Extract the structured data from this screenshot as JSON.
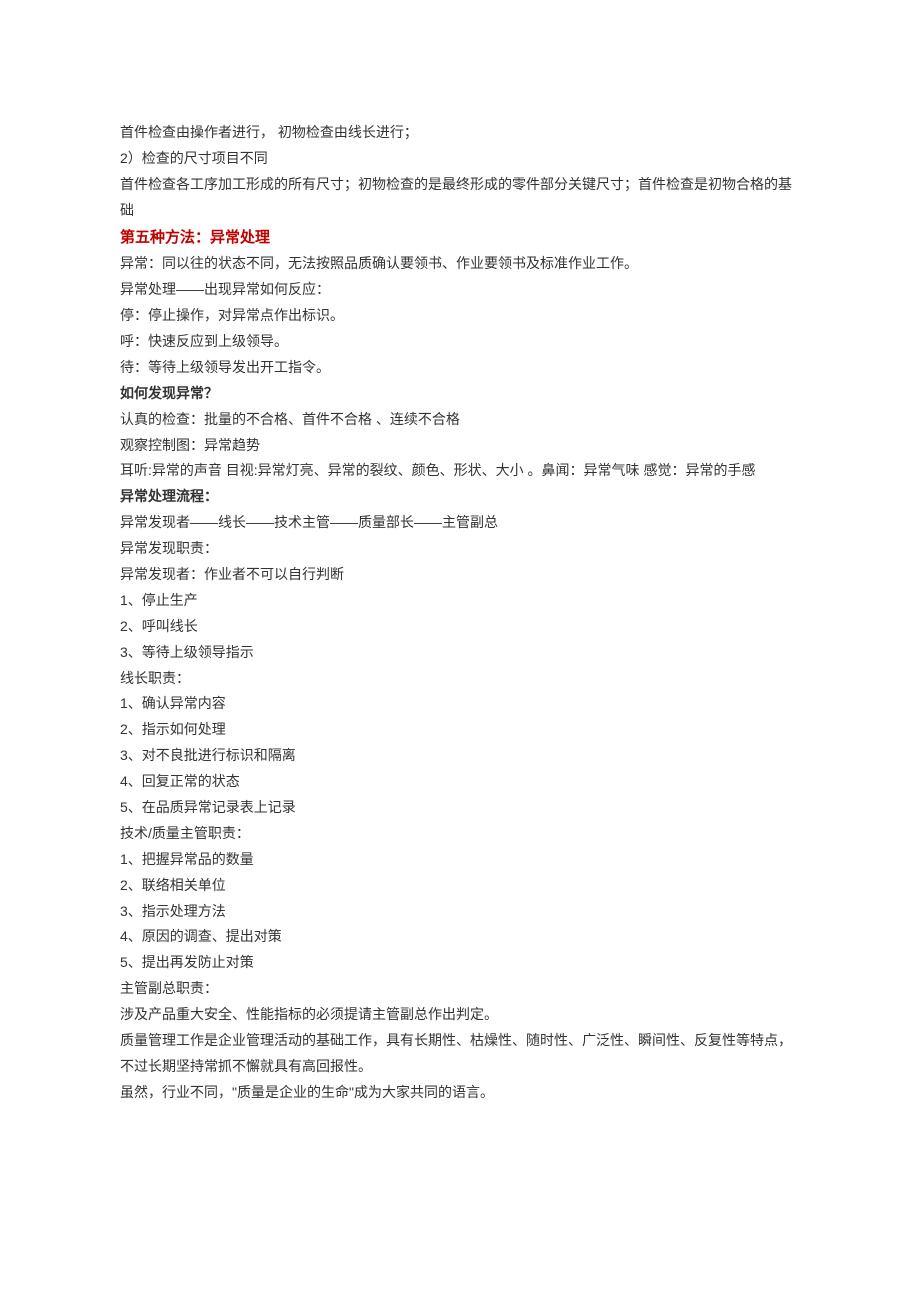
{
  "lines": [
    {
      "text": "首件检查由操作者进行，   初物检查由线长进行；",
      "class": ""
    },
    {
      "text": "2）检查的尺寸项目不同",
      "class": ""
    },
    {
      "text": "首件检查各工序加工形成的所有尺寸；初物检查的是最终形成的零件部分关键尺寸；首件检查是初物合格的基础",
      "class": ""
    },
    {
      "text": "第五种方法：异常处理",
      "class": "heading-red"
    },
    {
      "text": "异常：同以往的状态不同，无法按照品质确认要领书、作业要领书及标准作业工作。",
      "class": ""
    },
    {
      "text": "异常处理——出现异常如何反应：",
      "class": ""
    },
    {
      "text": "停：停止操作，对异常点作出标识。",
      "class": ""
    },
    {
      "text": "呼：快速反应到上级领导。",
      "class": ""
    },
    {
      "text": "待：等待上级领导发出开工指令。",
      "class": ""
    },
    {
      "text": "如何发现异常？",
      "class": "bold"
    },
    {
      "text": "认真的检查：批量的不合格、首件不合格 、连续不合格",
      "class": ""
    },
    {
      "text": "观察控制图：异常趋势",
      "class": ""
    },
    {
      "text": "耳听:异常的声音  目视:异常灯亮、异常的裂纹、颜色、形状、大小 。鼻闻：异常气味   感觉：异常的手感",
      "class": ""
    },
    {
      "text": "异常处理流程：",
      "class": "bold"
    },
    {
      "text": "异常发现者——线长——技术主管——质量部长——主管副总",
      "class": ""
    },
    {
      "text": "异常发现职责：",
      "class": ""
    },
    {
      "text": "异常发现者：作业者不可以自行判断",
      "class": ""
    },
    {
      "text": "1、停止生产",
      "class": ""
    },
    {
      "text": "2、呼叫线长",
      "class": ""
    },
    {
      "text": "3、等待上级领导指示",
      "class": ""
    },
    {
      "text": "线长职责：",
      "class": ""
    },
    {
      "text": "1、确认异常内容",
      "class": ""
    },
    {
      "text": "2、指示如何处理",
      "class": ""
    },
    {
      "text": "3、对不良批进行标识和隔离",
      "class": ""
    },
    {
      "text": "4、回复正常的状态",
      "class": ""
    },
    {
      "text": "5、在品质异常记录表上记录",
      "class": ""
    },
    {
      "text": "技术/质量主管职责：",
      "class": ""
    },
    {
      "text": "1、把握异常品的数量",
      "class": ""
    },
    {
      "text": "2、联络相关单位",
      "class": ""
    },
    {
      "text": "3、指示处理方法",
      "class": ""
    },
    {
      "text": "4、原因的调查、提出对策",
      "class": ""
    },
    {
      "text": "5、提出再发防止对策",
      "class": ""
    },
    {
      "text": "主管副总职责：",
      "class": ""
    },
    {
      "text": "涉及产品重大安全、性能指标的必须提请主管副总作出判定。",
      "class": ""
    },
    {
      "text": "质量管理工作是企业管理活动的基础工作，具有长期性、枯燥性、随时性、广泛性、瞬间性、反复性等特点，不过长期坚持常抓不懈就具有高回报性。",
      "class": ""
    },
    {
      "text": "虽然，行业不同，\"质量是企业的生命\"成为大家共同的语言。",
      "class": ""
    }
  ]
}
